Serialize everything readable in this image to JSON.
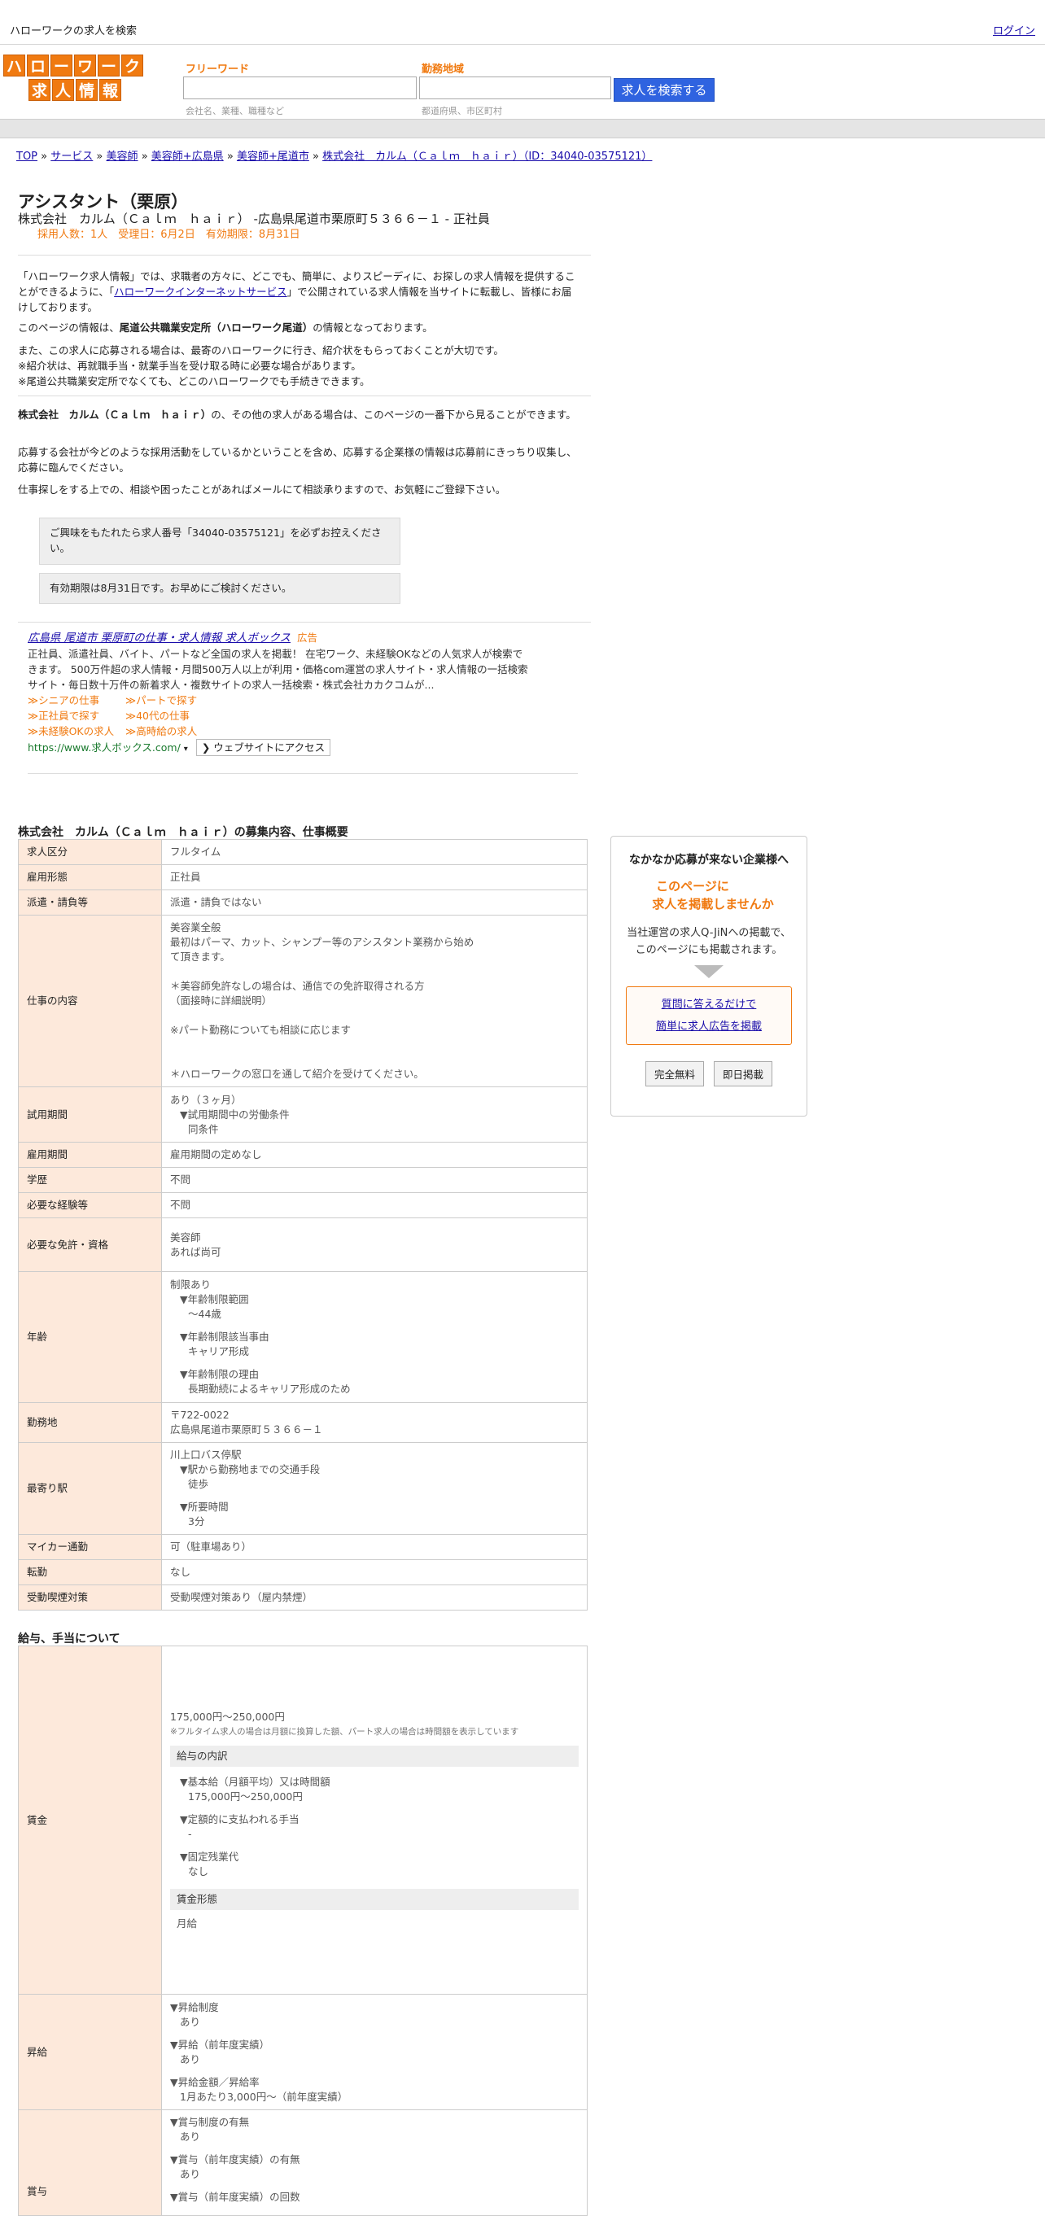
{
  "topbar": {
    "site_title": "ハローワークの求人を検索",
    "login": "ログイン"
  },
  "logo": {
    "row1": [
      "ハ",
      "ロ",
      "ー",
      "ワ",
      "ー",
      "ク"
    ],
    "row2": [
      "求",
      "人",
      "情",
      "報"
    ]
  },
  "search": {
    "keyword_label": "フリーワード",
    "keyword_placeholder": "会社名、業種、職種など",
    "area_label": "勤務地域",
    "area_placeholder": "都道府県、市区町村",
    "button": "求人を検索する"
  },
  "breadcrumb": {
    "items": [
      "TOP",
      "サービス",
      "美容師",
      "美容師+広島県",
      "美容師+尾道市",
      "株式会社　カルム（Ｃａｌｍ　ｈａｉｒ）（ID：34040-03575121）"
    ],
    "sep": "»"
  },
  "job": {
    "title": "アシスタント（栗原）",
    "company_line": "株式会社　カルム（Ｃａｌｍ　ｈａｉｒ） -広島県尾道市栗原町５３６６－１ - 正社員",
    "meta": "採用人数：1人　受理日：6月2日　有効期限：8月31日"
  },
  "intro": {
    "p1_a": "「ハローワーク求人情報」では、求職者の方々に、どこでも、簡単に、よりスピーディに、お探しの求人情報を提供することができるように、「",
    "p1_link": "ハローワークインターネットサービス",
    "p1_b": "」で公開されている求人情報を当サイトに転載し、皆様にお届けしております。",
    "p2_a": "このページの情報は、",
    "p2_bold": "尾道公共職業安定所（ハローワーク尾道）",
    "p2_b": "の情報となっております。",
    "p3_l1": "また、この求人に応募される場合は、最寄のハローワークに行き、紹介状をもらっておくことが大切です。",
    "p3_l2": "※紹介状は、再就職手当・就業手当を受け取る時に必要な場合があります。",
    "p3_l3": "※尾道公共職業安定所でなくても、どこのハローワークでも手続きできます。",
    "p4_bold": "株式会社　カルム（Ｃａｌｍ　ｈａｉｒ）",
    "p4_b": "の、その他の求人がある場合は、このページの一番下から見ることができます。",
    "p5": "応募する会社が今どのような採用活動をしているかということを含め、応募する企業様の情報は応募前にきっちり収集し、応募に臨んでください。",
    "p6": "仕事探しをする上での、相談や困ったことがあればメールにて相談承りますので、お気軽にご登録下さい。"
  },
  "notices": {
    "n1": "ご興味をもたれたら求人番号「34040-03575121」を必ずお控えください。",
    "n2": "有効期限は8月31日です。お早めにご検討ください。"
  },
  "ad": {
    "title": "広島県 尾道市 栗原町の仕事・求人情報 求人ボックス",
    "tag": "広告",
    "desc": "正社員、派遣社員、バイト、パートなど全国の求人を掲載！ 在宅ワーク、未経験OKなどの人気求人が検索できます。 500万件超の求人情報・月間500万人以上が利用・価格com運営の求人サイト・求人情報の一括検索サイト・毎日数十万件の新着求人・複数サイトの求人一括検索・株式会社カカクコムが...",
    "links": [
      "≫シニアの仕事",
      "≫パートで探す",
      "≫正社員で探す",
      "≫40代の仕事",
      "≫未経験OKの求人",
      "≫高時給の求人"
    ],
    "url": "https://www.求人ボックス.com/",
    "url_dropdown": "▾",
    "visit": "❯ ウェブサイトにアクセス"
  },
  "overview": {
    "title": "株式会社　カルム（Ｃａｌｍ　ｈａｉｒ）の募集内容、仕事概要",
    "rows": {
      "kubun": {
        "k": "求人区分",
        "v": "フルタイム"
      },
      "koyo": {
        "k": "雇用形態",
        "v": "正社員"
      },
      "haken": {
        "k": "派遣・請負等",
        "v": "派遣・請負ではない"
      },
      "naiyo": {
        "k": "仕事の内容",
        "v1": "美容業全般",
        "v2": "最初はパーマ、カット、シャンプー等のアシスタント業務から始め",
        "v3": "て頂きます。",
        "v4": "＊美容師免許なしの場合は、通信での免許取得される方",
        "v5": "（面接時に詳細説明）",
        "v6": "※パート勤務についても相談に応じます",
        "v7": "＊ハローワークの窓口を通して紹介を受けてください。"
      },
      "shiyo": {
        "k": "試用期間",
        "v1": "あり（３ヶ月）",
        "v2": "▼試用期間中の労働条件",
        "v3": "同条件"
      },
      "koyokikan": {
        "k": "雇用期間",
        "v": "雇用期間の定めなし"
      },
      "gakureki": {
        "k": "学歴",
        "v": "不問"
      },
      "keiken": {
        "k": "必要な経験等",
        "v": "不問"
      },
      "menkyo": {
        "k": "必要な免許・資格",
        "v1": "美容師",
        "v2": "あれば尚可"
      },
      "nenrei": {
        "k": "年齢",
        "v1": "制限あり",
        "v2": "▼年齢制限範囲",
        "v3": "〜44歳",
        "v4": "▼年齢制限該当事由",
        "v5": "キャリア形成",
        "v6": "▼年齢制限の理由",
        "v7": "長期勤続によるキャリア形成のため"
      },
      "kinmuchi": {
        "k": "勤務地",
        "v1": "〒722-0022",
        "v2": "広島県尾道市栗原町５３６６－１"
      },
      "eki": {
        "k": "最寄り駅",
        "v1": "川上口バス停駅",
        "v2": "▼駅から勤務地までの交通手段",
        "v3": "徒歩",
        "v4": "▼所要時間",
        "v5": "3分"
      },
      "mycar": {
        "k": "マイカー通勤",
        "v": "可（駐車場あり）"
      },
      "tenkin": {
        "k": "転勤",
        "v": "なし"
      },
      "kitsuen": {
        "k": "受動喫煙対策",
        "v": "受動喫煙対策あり（屋内禁煙）"
      }
    }
  },
  "salary": {
    "title": "給与、手当について",
    "chingin": {
      "k": "賃金",
      "range": "175,000円〜250,000円",
      "note": "※フルタイム求人の場合は月額に換算した額、パート求人の場合は時間額を表示しています",
      "breakdown_head": "給与の内訳",
      "b1": "▼基本給（月額平均）又は時間額",
      "b1v": "175,000円〜250,000円",
      "b2": "▼定額的に支払われる手当",
      "b2v": "-",
      "b3": "▼固定残業代",
      "b3v": "なし",
      "form_head": "賃金形態",
      "form": "月給"
    },
    "shokyu": {
      "k": "昇給",
      "a1": "▼昇給制度",
      "a1v": "あり",
      "a2": "▼昇給（前年度実績）",
      "a2v": "あり",
      "a3": "▼昇給金額／昇給率",
      "a3v": "1月あたり3,000円〜（前年度実績）"
    },
    "shoyo": {
      "k": "賞与",
      "a1": "▼賞与制度の有無",
      "a1v": "あり",
      "a2": "▼賞与（前年度実績）の有無",
      "a2v": "あり",
      "a3": "▼賞与（前年度実績）の回数"
    }
  },
  "sidebar": {
    "heading": "なかなか応募が来ない企業様へ",
    "offer1": "このページに",
    "offer2": "求人を掲載しませんか",
    "text1": "当社運営の求人Q-JiNへの掲載で、",
    "text2": "このページにも掲載されます。",
    "link1": "質問に答えるだけで",
    "link2": "簡単に求人広告を掲載",
    "btn_free": "完全無料",
    "btn_now": "即日掲載"
  }
}
